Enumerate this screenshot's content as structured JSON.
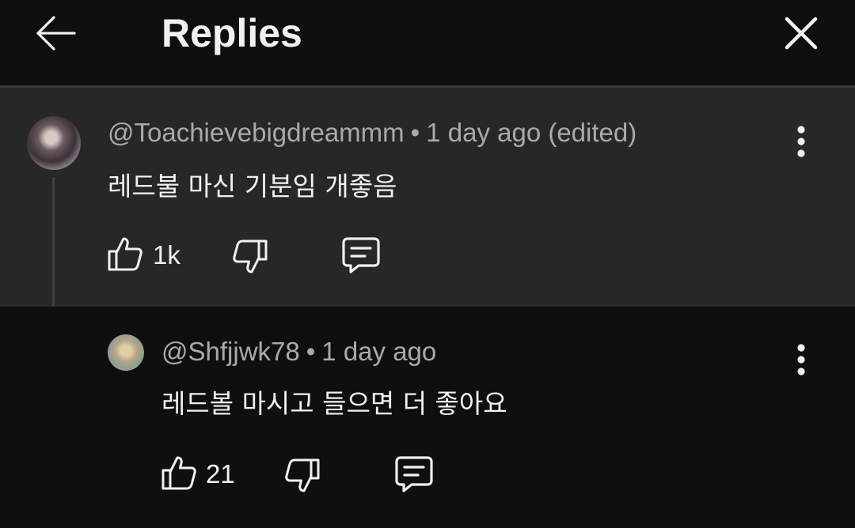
{
  "header": {
    "title": "Replies",
    "back_icon": "arrow-left-icon",
    "close_icon": "close-icon"
  },
  "comments": [
    {
      "handle": "@Toachievebigdreammm",
      "separator": "•",
      "time": "1 day ago (edited)",
      "text": "레드불 마신 기분임 개좋음",
      "likes": "1k"
    },
    {
      "handle": "@Shfjjwk78",
      "separator": "•",
      "time": "1 day ago",
      "text": "레드볼 마시고 들으면 더 좋아요",
      "likes": "21"
    }
  ],
  "colors": {
    "background": "#0f0f0f",
    "highlight": "#272727",
    "text": "#f1f1f1",
    "muted": "#aaaaaa"
  }
}
